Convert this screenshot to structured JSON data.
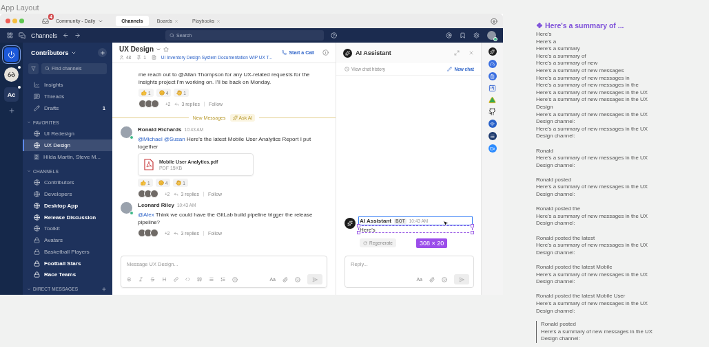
{
  "canvas_title": "App Layout",
  "window": {
    "team_badge": "4",
    "workspace": "Community - Daily",
    "tabs": [
      {
        "label": "Channels",
        "selected": true,
        "closable": false
      },
      {
        "label": "Boards",
        "selected": false,
        "closable": true
      },
      {
        "label": "Playbooks",
        "selected": false,
        "closable": true
      }
    ]
  },
  "header": {
    "product": "Channels",
    "search_placeholder": "Search"
  },
  "teams": [
    {
      "kind": "logo",
      "selected": true,
      "unread": false
    },
    {
      "kind": "avatar",
      "selected": false,
      "unread": true
    },
    {
      "kind": "initials",
      "label": "Ac",
      "selected": false,
      "unread": true
    }
  ],
  "sidebar": {
    "team": "Contributors",
    "find_placeholder": "Find channels",
    "nav": [
      {
        "kind": "insights",
        "label": "Insights"
      },
      {
        "kind": "threads",
        "label": "Threads"
      },
      {
        "kind": "drafts",
        "label": "Drafts",
        "count": "1"
      }
    ],
    "sections": [
      {
        "title": "FAVORITES",
        "addable": false,
        "items": [
          {
            "kind": "public",
            "label": "UI Redesign",
            "unread": false,
            "selected": false
          },
          {
            "kind": "public",
            "label": "UX Design",
            "unread": false,
            "selected": true
          },
          {
            "kind": "group",
            "badge": "2",
            "label": "Hilda Martin, Steve M...",
            "unread": false,
            "selected": false
          }
        ]
      },
      {
        "title": "CHANNELS",
        "addable": false,
        "items": [
          {
            "kind": "public",
            "label": "Contributors",
            "unread": false,
            "selected": false
          },
          {
            "kind": "public",
            "label": "Developers",
            "unread": false,
            "selected": false
          },
          {
            "kind": "public",
            "label": "Desktop App",
            "unread": true,
            "selected": false
          },
          {
            "kind": "public",
            "label": "Release Discussion",
            "unread": true,
            "selected": false
          },
          {
            "kind": "public",
            "label": "Toolkit",
            "unread": false,
            "selected": false
          },
          {
            "kind": "private",
            "label": "Avatars",
            "unread": false,
            "selected": false
          },
          {
            "kind": "private",
            "label": "Basketball Players",
            "unread": false,
            "selected": false
          },
          {
            "kind": "private",
            "label": "Football Stars",
            "unread": true,
            "selected": false
          },
          {
            "kind": "private",
            "label": "Race Teams",
            "unread": true,
            "selected": false
          }
        ]
      },
      {
        "title": "DIRECT MESSAGES",
        "addable": true
      }
    ]
  },
  "channel": {
    "name": "UX Design",
    "members": "48",
    "pinned": "1",
    "bookmark": "UI Inventory Design System Documentation WIP UX T...",
    "call": "Start a Call"
  },
  "messages": [
    {
      "kind": "continuation",
      "text": "me reach out to @Allan Thompson for any UX-related requests for the insights project I'm working on. I'll be back on Monday.",
      "reactions": [
        {
          "kind": "thumbs",
          "count": "1"
        },
        {
          "kind": "smile",
          "count": "4"
        },
        {
          "kind": "hands",
          "count": "1"
        }
      ],
      "thread": {
        "more": "+2",
        "replies": "3 replies",
        "follow": "Follow"
      }
    },
    {
      "kind": "divider",
      "label": "New Messages",
      "action": "Ask AI"
    },
    {
      "kind": "post",
      "author": "Ronald Richards",
      "time": "10:43 AM",
      "mention": "@Michael @Susan",
      "text": "Here's the latest Mobile User Analytics Report I put together",
      "file": {
        "name": "Mobile User Analytics.pdf",
        "meta": "PDF 15KB"
      },
      "reactions": [
        {
          "kind": "thumbs",
          "count": "1"
        },
        {
          "kind": "smile",
          "count": "4"
        },
        {
          "kind": "hands",
          "count": "1"
        }
      ],
      "thread": {
        "more": "+2",
        "replies": "3 replies",
        "follow": "Follow"
      }
    },
    {
      "kind": "post",
      "author": "Leonard Riley",
      "time": "10:43 AM",
      "mention": "@Alex",
      "text": "Think we could have the GitLab build pipeline trigger the release pipeline?",
      "thread": {
        "more": "+2",
        "replies": "3 replies",
        "follow": "Follow"
      }
    }
  ],
  "composer": {
    "placeholder": "Message UX Design...",
    "format_label": "Aa"
  },
  "assistant": {
    "title": "AI Assistant",
    "history": "View chat history",
    "new_chat": "New chat",
    "message": {
      "author": "AI Assistant",
      "badge": "BOT",
      "time": "10:43 AM",
      "text": "Here's",
      "action": "Regenerate"
    },
    "selection_size": "308 × 20",
    "reply_placeholder": "Reply...",
    "format_label": "Aa"
  },
  "summary": {
    "title": "❖ Here's a summary of ...",
    "entries": [
      {
        "kind": "plain",
        "text": "Here's"
      },
      {
        "kind": "plain",
        "text": "Here's a"
      },
      {
        "kind": "plain",
        "text": "Here's a summary"
      },
      {
        "kind": "plain",
        "text": "Here's a summary of"
      },
      {
        "kind": "plain",
        "text": "Here's a summary of new"
      },
      {
        "kind": "plain",
        "text": "Here's a summary of new messages"
      },
      {
        "kind": "plain",
        "text": "Here's a summary of new messages in"
      },
      {
        "kind": "plain",
        "text": "Here's a summary of new messages in the"
      },
      {
        "kind": "plain",
        "text": "Here's a summary of new messages in the UX"
      },
      {
        "kind": "plain",
        "text": "Here's a summary of new messages in the UX\nDesign"
      },
      {
        "kind": "plain",
        "text": "Here's a summary of new messages in the UX\nDesign channel:"
      },
      {
        "kind": "plain",
        "text": "Here's a summary of new messages in the UX\nDesign channel:\n\nRonald"
      },
      {
        "kind": "plain",
        "text": "Here's a summary of new messages in the UX\nDesign channel:\n\nRonald posted"
      },
      {
        "kind": "plain",
        "text": "Here's a summary of new messages in the UX\nDesign channel:\n\nRonald posted the"
      },
      {
        "kind": "plain",
        "text": "Here's a summary of new messages in the UX\nDesign channel:\n\nRonald posted the latest"
      },
      {
        "kind": "plain",
        "text": "Here's a summary of new messages in the UX\nDesign channel:\n\nRonald posted the latest Mobile"
      },
      {
        "kind": "plain",
        "text": "Here's a summary of new messages in the UX\nDesign channel:\n\nRonald posted the latest Mobile User"
      },
      {
        "kind": "plain",
        "text": "Here's a summary of new messages in the UX\nDesign channel:"
      },
      {
        "kind": "marked",
        "text": "Ronald posted\nHere's a summary of new messages in the UX\nDesign channel:"
      }
    ]
  }
}
